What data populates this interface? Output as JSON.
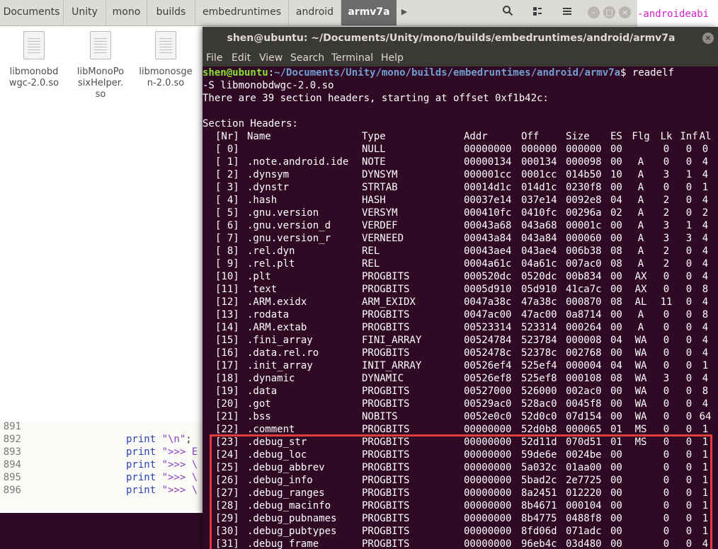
{
  "file_manager": {
    "breadcrumbs": [
      "Documents",
      "Unity",
      "mono",
      "builds",
      "embedruntimes",
      "android",
      "armv7a"
    ],
    "active_crumb": "armv7a",
    "files": [
      {
        "name": "libmonobdwgc-2.0.so",
        "line1": "libmonobd",
        "line2": "wgc-2.0.so",
        "line3": ""
      },
      {
        "name": "libMonoPosixHelper.so",
        "line1": "libMonoPo",
        "line2": "sixHelper.",
        "line3": "so"
      },
      {
        "name": "libmonosgen-2.0.so",
        "line1": "libmonosge",
        "line2": "n-2.0.so",
        "line3": ""
      }
    ]
  },
  "background_terminal_text": "-androideabi",
  "editor": {
    "lines": [
      {
        "num": "891",
        "code": "",
        "str": ""
      },
      {
        "num": "892",
        "code": "print ",
        "str": "\"\\n\"",
        "rest": ";"
      },
      {
        "num": "893",
        "code": "print ",
        "str": "\">>> E",
        "rest": ""
      },
      {
        "num": "894",
        "code": "print ",
        "str": "\">>> \\",
        "rest": ""
      },
      {
        "num": "895",
        "code": "print ",
        "str": "\">>> \\",
        "rest": ""
      },
      {
        "num": "896",
        "code": "print ",
        "str": "\">>> \\",
        "rest": ""
      }
    ]
  },
  "terminal": {
    "title": "shen@ubuntu: ~/Documents/Unity/mono/builds/embedruntimes/android/armv7a",
    "menu": [
      "File",
      "Edit",
      "View",
      "Search",
      "Terminal",
      "Help"
    ],
    "prompt_user": "shen@ubuntu",
    "prompt_path": "~/Documents/Unity/mono/builds/embedruntimes/android/armv7a",
    "command_part1": "readelf",
    "command_part2": "-S libmonobdwgc-2.0.so",
    "summary": "There are 39 section headers, starting at offset 0xf1b42c:",
    "heading": "Section Headers:",
    "columns": [
      "[Nr]",
      "Name",
      "Type",
      "Addr",
      "Off",
      "Size",
      "ES",
      "Flg",
      "Lk",
      "Inf",
      "Al"
    ],
    "sections": [
      [
        "[ 0]",
        "",
        "NULL",
        "00000000",
        "000000",
        "000000",
        "00",
        "",
        "0",
        "0",
        "0"
      ],
      [
        "[ 1]",
        ".note.android.ide",
        "NOTE",
        "00000134",
        "000134",
        "000098",
        "00",
        "A",
        "0",
        "0",
        "4"
      ],
      [
        "[ 2]",
        ".dynsym",
        "DYNSYM",
        "000001cc",
        "0001cc",
        "014b50",
        "10",
        "A",
        "3",
        "1",
        "4"
      ],
      [
        "[ 3]",
        ".dynstr",
        "STRTAB",
        "00014d1c",
        "014d1c",
        "0230f8",
        "00",
        "A",
        "0",
        "0",
        "1"
      ],
      [
        "[ 4]",
        ".hash",
        "HASH",
        "00037e14",
        "037e14",
        "0092e8",
        "04",
        "A",
        "2",
        "0",
        "4"
      ],
      [
        "[ 5]",
        ".gnu.version",
        "VERSYM",
        "000410fc",
        "0410fc",
        "00296a",
        "02",
        "A",
        "2",
        "0",
        "2"
      ],
      [
        "[ 6]",
        ".gnu.version_d",
        "VERDEF",
        "00043a68",
        "043a68",
        "00001c",
        "00",
        "A",
        "3",
        "1",
        "4"
      ],
      [
        "[ 7]",
        ".gnu.version_r",
        "VERNEED",
        "00043a84",
        "043a84",
        "000060",
        "00",
        "A",
        "3",
        "3",
        "4"
      ],
      [
        "[ 8]",
        ".rel.dyn",
        "REL",
        "00043ae4",
        "043ae4",
        "006b38",
        "08",
        "A",
        "2",
        "0",
        "4"
      ],
      [
        "[ 9]",
        ".rel.plt",
        "REL",
        "0004a61c",
        "04a61c",
        "007ac0",
        "08",
        "A",
        "2",
        "0",
        "4"
      ],
      [
        "[10]",
        ".plt",
        "PROGBITS",
        "000520dc",
        "0520dc",
        "00b834",
        "00",
        "AX",
        "0",
        "0",
        "4"
      ],
      [
        "[11]",
        ".text",
        "PROGBITS",
        "0005d910",
        "05d910",
        "41ca7c",
        "00",
        "AX",
        "0",
        "0",
        "8"
      ],
      [
        "[12]",
        ".ARM.exidx",
        "ARM_EXIDX",
        "0047a38c",
        "47a38c",
        "000870",
        "08",
        "AL",
        "11",
        "0",
        "4"
      ],
      [
        "[13]",
        ".rodata",
        "PROGBITS",
        "0047ac00",
        "47ac00",
        "0a8714",
        "00",
        "A",
        "0",
        "0",
        "8"
      ],
      [
        "[14]",
        ".ARM.extab",
        "PROGBITS",
        "00523314",
        "523314",
        "000264",
        "00",
        "A",
        "0",
        "0",
        "4"
      ],
      [
        "[15]",
        ".fini_array",
        "FINI_ARRAY",
        "00524784",
        "523784",
        "000008",
        "04",
        "WA",
        "0",
        "0",
        "4"
      ],
      [
        "[16]",
        ".data.rel.ro",
        "PROGBITS",
        "0052478c",
        "52378c",
        "002768",
        "00",
        "WA",
        "0",
        "0",
        "4"
      ],
      [
        "[17]",
        ".init_array",
        "INIT_ARRAY",
        "00526ef4",
        "525ef4",
        "000004",
        "04",
        "WA",
        "0",
        "0",
        "1"
      ],
      [
        "[18]",
        ".dynamic",
        "DYNAMIC",
        "00526ef8",
        "525ef8",
        "000108",
        "08",
        "WA",
        "3",
        "0",
        "4"
      ],
      [
        "[19]",
        ".data",
        "PROGBITS",
        "00527000",
        "526000",
        "002ac0",
        "00",
        "WA",
        "0",
        "0",
        "8"
      ],
      [
        "[20]",
        ".got",
        "PROGBITS",
        "00529ac0",
        "528ac0",
        "0045f8",
        "00",
        "WA",
        "0",
        "0",
        "4"
      ],
      [
        "[21]",
        ".bss",
        "NOBITS",
        "0052e0c0",
        "52d0c0",
        "07d154",
        "00",
        "WA",
        "0",
        "0",
        "64"
      ],
      [
        "[22]",
        ".comment",
        "PROGBITS",
        "00000000",
        "52d0b8",
        "000065",
        "01",
        "MS",
        "0",
        "0",
        "1"
      ],
      [
        "[23]",
        ".debug_str",
        "PROGBITS",
        "00000000",
        "52d11d",
        "070d51",
        "01",
        "MS",
        "0",
        "0",
        "1"
      ],
      [
        "[24]",
        ".debug_loc",
        "PROGBITS",
        "00000000",
        "59de6e",
        "0024be",
        "00",
        "",
        "0",
        "0",
        "1"
      ],
      [
        "[25]",
        ".debug_abbrev",
        "PROGBITS",
        "00000000",
        "5a032c",
        "01aa00",
        "00",
        "",
        "0",
        "0",
        "1"
      ],
      [
        "[26]",
        ".debug_info",
        "PROGBITS",
        "00000000",
        "5bad2c",
        "2e7725",
        "00",
        "",
        "0",
        "0",
        "1"
      ],
      [
        "[27]",
        ".debug_ranges",
        "PROGBITS",
        "00000000",
        "8a2451",
        "012220",
        "00",
        "",
        "0",
        "0",
        "1"
      ],
      [
        "[28]",
        ".debug_macinfo",
        "PROGBITS",
        "00000000",
        "8b4671",
        "000104",
        "00",
        "",
        "0",
        "0",
        "1"
      ],
      [
        "[29]",
        ".debug_pubnames",
        "PROGBITS",
        "00000000",
        "8b4775",
        "0488f8",
        "00",
        "",
        "0",
        "0",
        "1"
      ],
      [
        "[30]",
        ".debug_pubtypes",
        "PROGBITS",
        "00000000",
        "8fd06d",
        "071adc",
        "00",
        "",
        "0",
        "0",
        "1"
      ],
      [
        "[31]",
        ".debug_frame",
        "PROGBITS",
        "00000000",
        "96eb4c",
        "03d480",
        "00",
        "",
        "0",
        "0",
        "4"
      ]
    ]
  },
  "colors": {
    "terminal_bg": "#300a24",
    "prompt_user": "#8ae234",
    "prompt_path": "#729fcf",
    "highlight_box": "#e03c3c"
  }
}
